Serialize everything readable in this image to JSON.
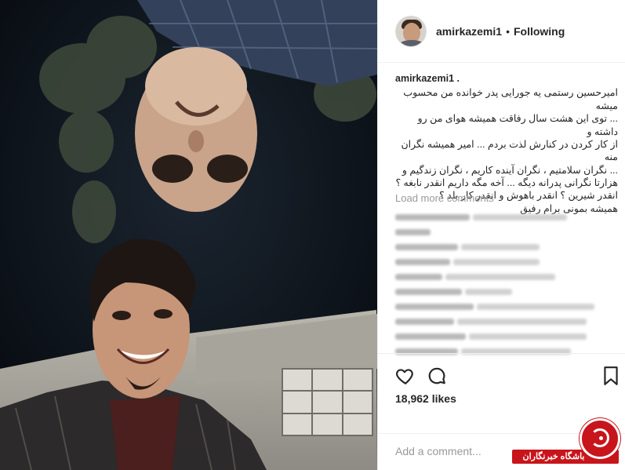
{
  "post": {
    "username": "amirkazemi1",
    "separator": "•",
    "follow_status": "Following"
  },
  "caption": {
    "username": "amirkazemi1 .",
    "text": "امیرحسین رستمی یه جورایی پدر خوانده من محسوب میشه\n... توی این هشت سال رفاقت همیشه هوای من رو داشته و\nاز کار کردن در کنارش لذت بردم ... امیر همیشه نگران منه\n... نگران سلامتیم ، نگران آینده کاریم ، نگران زندگیم و\nهزارتا نگرانی پدرانه دیگه ... آخه مگه داریم انقدر نابغه ؟\nانقدر شیرین ؟ انقدر باهوش و انقدر کار بلد ؟\nهمیشه بمونی برام رفیق"
  },
  "comments": {
    "load_more_label": "Load more comments"
  },
  "actions": {
    "like_icon": "heart-outline-icon",
    "comment_icon": "speech-bubble-icon",
    "save_icon": "bookmark-icon"
  },
  "likes": {
    "count": "18,962",
    "label": "likes"
  },
  "add_comment": {
    "placeholder": "Add a comment..."
  },
  "watermark": {
    "text": "باشگاه خبرنگاران"
  },
  "colors": {
    "text": "#262626",
    "muted": "#999999",
    "border": "#efefef",
    "watermark_red": "#c8151b"
  }
}
